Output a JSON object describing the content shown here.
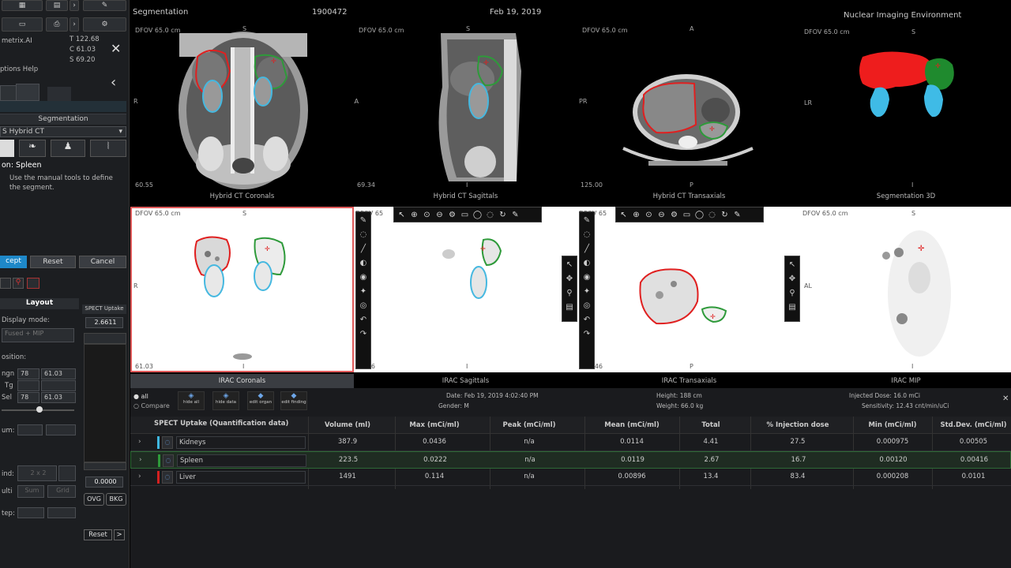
{
  "left": {
    "app_name": "metrix.AI",
    "coords": {
      "t": "T 122.68",
      "c": "C 61.03",
      "s": "S 69.20"
    },
    "menu": "ptions  Help",
    "segmentation_header": "Segmentation",
    "dataset": "S Hybrid CT",
    "segment_label": "on: Spleen",
    "instruction": "Use the manual tools to define the segment.",
    "buttons": {
      "accept": "cept",
      "reset": "Reset",
      "cancel": "Cancel"
    },
    "layout_header": "Layout",
    "display_mode_label": "Display mode:",
    "display_mode_value": "Fused + MIP",
    "spect_uptake_label": "SPECT Uptake",
    "spect_uptake_value": "2.6611",
    "position_label": "osition:",
    "pos_rows": [
      {
        "label": "ngn",
        "a": "78",
        "b": "61.03"
      },
      {
        "label": "Tg",
        "a": "",
        "b": ""
      },
      {
        "label": "Sel",
        "a": "78",
        "b": "61.03"
      }
    ],
    "num_label": "um:",
    "grid_label": "ind:",
    "grid_value": "2 x 2",
    "mode_label": "ulti",
    "mode_values": [
      "Sum",
      "Grid"
    ],
    "step_label": "tep:",
    "lower_value": "0.0000",
    "ovg_label": "OVG",
    "bkg_label": "BKG",
    "reset_label": "Reset",
    "arrow_label": ">"
  },
  "header": {
    "segmentation": "Segmentation",
    "patient_id": "1900472",
    "date": "Feb 19, 2019",
    "env": "Nuclear Imaging Environment"
  },
  "viewports": [
    {
      "dfov": "DFOV 65.0 cm",
      "top": "S",
      "left": "R",
      "bottom": "I",
      "corner": "60.55",
      "caption": "Hybrid CT Coronals"
    },
    {
      "dfov": "DFOV 65.0 cm",
      "top": "S",
      "left": "LA",
      "bottom": "I",
      "corner": "69.34",
      "caption": "Hybrid CT Sagittals"
    },
    {
      "dfov": "DFOV 65.0 cm",
      "top": "A",
      "left": "PR",
      "bottom": "P",
      "corner": "125.00",
      "caption": "Hybrid CT Transaxials"
    },
    {
      "dfov": "DFOV 65.0 cm",
      "top": "S",
      "left": "LR",
      "bottom": "I",
      "corner": "",
      "caption": "Segmentation 3D"
    },
    {
      "dfov": "DFOV 65.0 cm",
      "top": "S",
      "left": "R",
      "bottom": "I",
      "corner": "61.03",
      "caption": "IRAC Coronals"
    },
    {
      "dfov": "DFOV 65",
      "top": "S",
      "left": "L",
      "bottom": "I",
      "corner": "69.26",
      "caption": "IRAC Sagittals"
    },
    {
      "dfov": "DFOV 65",
      "top": "A",
      "left": "",
      "bottom": "P",
      "corner": "121.46",
      "caption": "IRAC Transaxials"
    },
    {
      "dfov": "DFOV 65.0 cm",
      "top": "S",
      "left": "AL",
      "bottom": "I",
      "corner": "",
      "caption": "IRAC MIP"
    }
  ],
  "info": {
    "radio_all": "all",
    "radio_compare": "Compare",
    "tool_btns": [
      "hide all",
      "hide data",
      "edit organ",
      "edit finding"
    ],
    "date": "Date: Feb 19, 2019 4:02:40 PM",
    "gender": "Gender: M",
    "height": "Height: 188 cm",
    "weight": "Weight: 66.0 kg",
    "injected": "Injected Dose: 16.0 mCi",
    "sensitivity": "Sensitivity: 12.43 cnt/min/uCi"
  },
  "table": {
    "title": "SPECT Uptake (Quantification data)",
    "columns": [
      "Volume (ml)",
      "Max (mCi/ml)",
      "Peak (mCi/ml)",
      "Mean (mCi/ml)",
      "Total",
      "% Injection dose",
      "Min (mCi/ml)",
      "Std.Dev. (mCi/ml)"
    ],
    "rows": [
      {
        "name": "Kidneys",
        "color": "#3fb7e0",
        "values": [
          "387.9",
          "0.0436",
          "n/a",
          "0.0114",
          "4.41",
          "27.5",
          "0.000975",
          "0.00505"
        ]
      },
      {
        "name": "Spleen",
        "color": "#2e9a3a",
        "values": [
          "223.5",
          "0.0222",
          "n/a",
          "0.0119",
          "2.67",
          "16.7",
          "0.00120",
          "0.00416"
        ]
      },
      {
        "name": "Liver",
        "color": "#d42020",
        "values": [
          "1491",
          "0.114",
          "n/a",
          "0.00896",
          "13.4",
          "83.4",
          "0.000208",
          "0.0101"
        ]
      }
    ]
  },
  "colors": {
    "liver": "#e02020",
    "spleen": "#2e9a3a",
    "kidney": "#45b8e0",
    "accent": "#1e88c8"
  }
}
